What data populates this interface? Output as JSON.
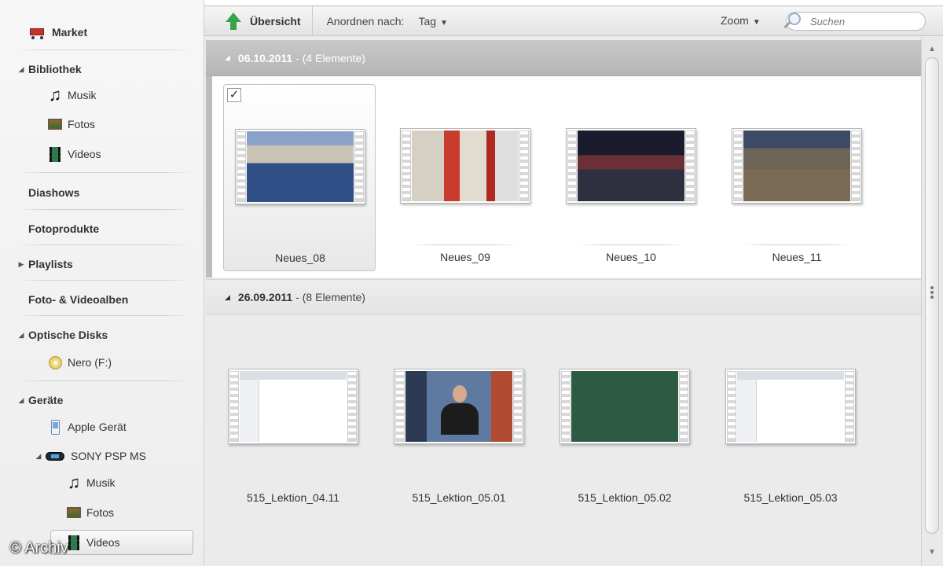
{
  "sidebar": {
    "market": "Market",
    "library": "Bibliothek",
    "library_items": [
      "Musik",
      "Fotos",
      "Videos"
    ],
    "slideshows": "Diashows",
    "photo_products": "Fotoprodukte",
    "playlists": "Playlists",
    "albums": "Foto- & Videoalben",
    "optical_disks": "Optische Disks",
    "disk_item": "Nero (F:)",
    "devices": "Geräte",
    "apple_device": "Apple Gerät",
    "psp": "SONY PSP MS",
    "psp_items": [
      "Musik",
      "Fotos",
      "Videos"
    ]
  },
  "toolbar": {
    "overview": "Übersicht",
    "arrange_label": "Anordnen nach:",
    "arrange_value": "Tag",
    "zoom": "Zoom",
    "search_placeholder": "Suchen"
  },
  "groups": [
    {
      "date": "06.10.2011",
      "count": "- (4 Elemente)",
      "items": [
        "Neues_08",
        "Neues_09",
        "Neues_10",
        "Neues_11"
      ]
    },
    {
      "date": "26.09.2011",
      "count": "- (8 Elemente)",
      "items": [
        "515_Lektion_04.11",
        "515_Lektion_05.01",
        "515_Lektion_05.02",
        "515_Lektion_05.03"
      ]
    }
  ],
  "checkmark": "✓",
  "watermark": "© Archiv"
}
